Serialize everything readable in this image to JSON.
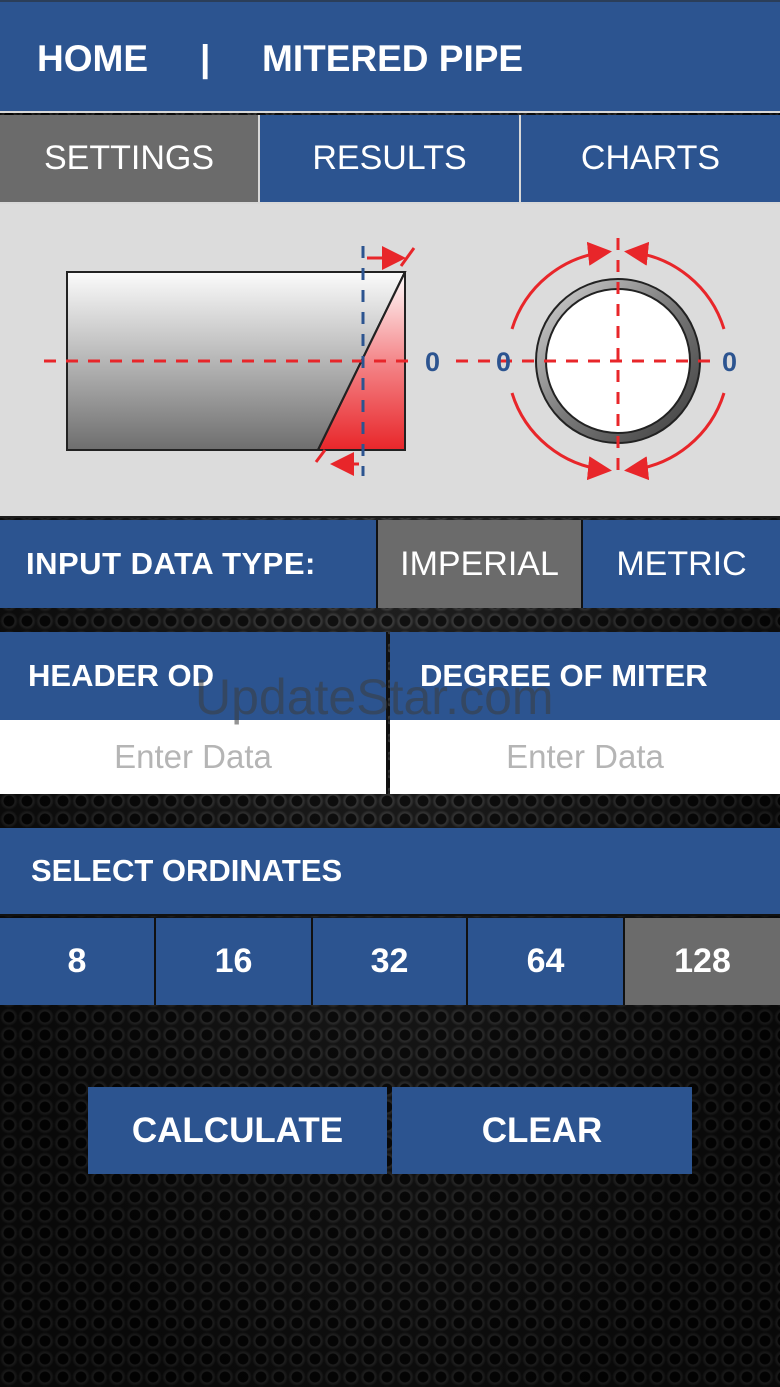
{
  "header": {
    "home_label": "HOME",
    "separator": "|",
    "title": "MITERED PIPE"
  },
  "tabs": [
    {
      "label": "SETTINGS",
      "active": true
    },
    {
      "label": "RESULTS",
      "active": false
    },
    {
      "label": "CHARTS",
      "active": false
    }
  ],
  "diagram": {
    "labels": [
      "0",
      "0",
      "0"
    ],
    "colors": {
      "accent_red": "#e8262a",
      "dashed_blue": "#2c5490"
    }
  },
  "input_type": {
    "label": "INPUT DATA TYPE:",
    "options": [
      {
        "label": "IMPERIAL",
        "selected": true
      },
      {
        "label": "METRIC",
        "selected": false
      }
    ]
  },
  "inputs": {
    "header_od": {
      "label": "HEADER OD",
      "placeholder": "Enter Data",
      "value": ""
    },
    "degree_of_miter": {
      "label": "DEGREE OF MITER",
      "placeholder": "Enter Data",
      "value": ""
    }
  },
  "watermark": "UpdateStar.com",
  "ordinates": {
    "label": "SELECT ORDINATES",
    "options": [
      {
        "label": "8",
        "selected": false
      },
      {
        "label": "16",
        "selected": false
      },
      {
        "label": "32",
        "selected": false
      },
      {
        "label": "64",
        "selected": false
      },
      {
        "label": "128",
        "selected": true
      }
    ]
  },
  "actions": {
    "calculate_label": "CALCULATE",
    "clear_label": "CLEAR"
  },
  "colors": {
    "primary_blue": "#2c5490",
    "selected_gray": "#6b6b6b",
    "panel_gray": "#dcdcdc"
  }
}
